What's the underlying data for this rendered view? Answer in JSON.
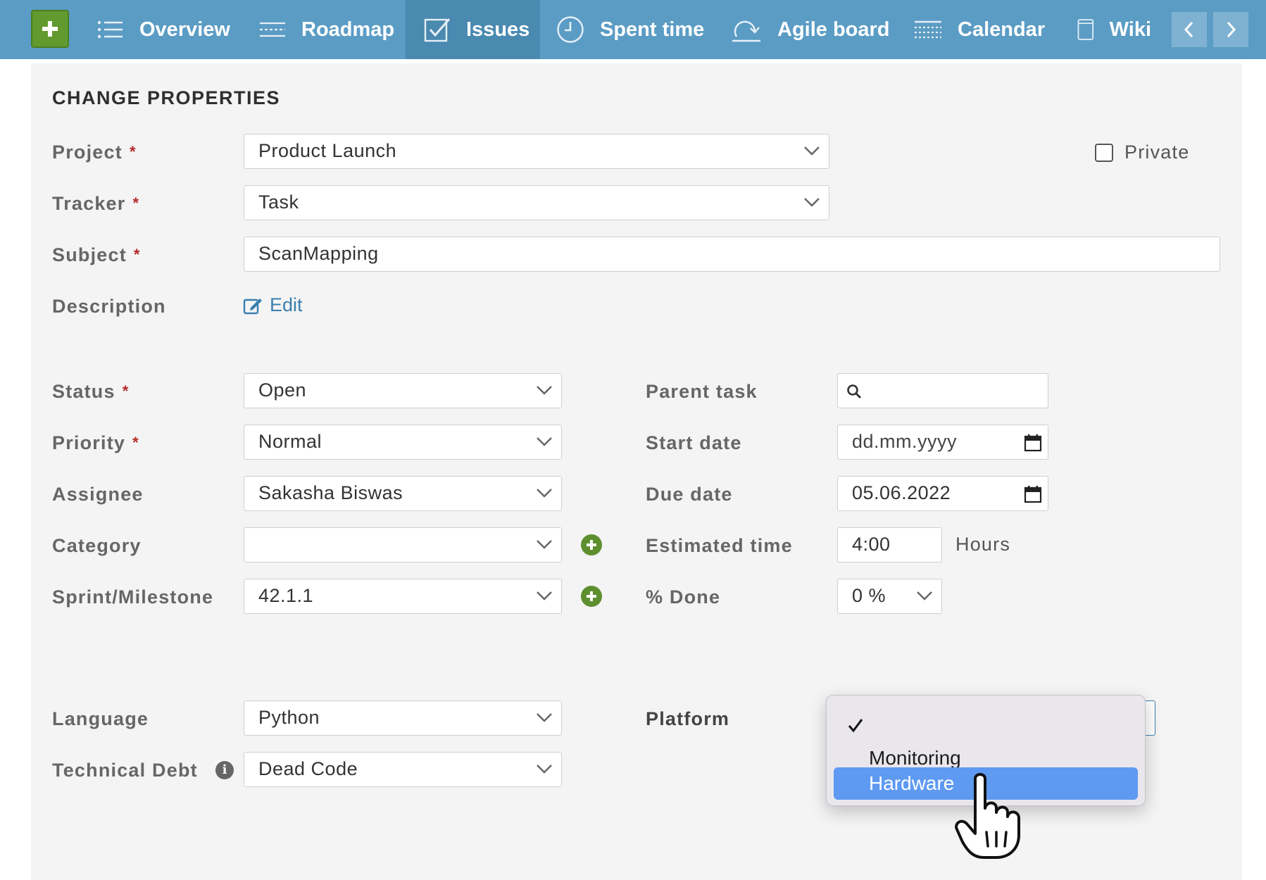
{
  "nav": {
    "add_label": "+",
    "items": [
      {
        "label": "Overview",
        "icon": "list-icon"
      },
      {
        "label": "Roadmap",
        "icon": "roadmap-icon"
      },
      {
        "label": "Issues",
        "icon": "checkbox-icon",
        "active": true
      },
      {
        "label": "Spent time",
        "icon": "clock-icon"
      },
      {
        "label": "Agile board",
        "icon": "agile-icon"
      },
      {
        "label": "Calendar",
        "icon": "calendar-icon"
      },
      {
        "label": "Wiki",
        "icon": "book-icon"
      }
    ],
    "prev_icon": "chevron-left-icon",
    "next_icon": "chevron-right-icon"
  },
  "form": {
    "title": "CHANGE PROPERTIES",
    "private_label": "Private",
    "private_checked": false,
    "project": {
      "label": "Project",
      "required": "*",
      "value": "Product Launch"
    },
    "tracker": {
      "label": "Tracker",
      "required": "*",
      "value": "Task"
    },
    "subject": {
      "label": "Subject",
      "required": "*",
      "value": "ScanMapping"
    },
    "description": {
      "label": "Description",
      "edit_label": "Edit"
    },
    "status": {
      "label": "Status",
      "required": "*",
      "value": "Open"
    },
    "priority": {
      "label": "Priority",
      "required": "*",
      "value": "Normal"
    },
    "assignee": {
      "label": "Assignee",
      "value": "Sakasha Biswas"
    },
    "category": {
      "label": "Category",
      "value": ""
    },
    "sprint": {
      "label": "Sprint/Milestone",
      "value": "42.1.1"
    },
    "parent_task": {
      "label": "Parent task",
      "value": ""
    },
    "start_date": {
      "label": "Start date",
      "value": "dd.mm.yyyy"
    },
    "due_date": {
      "label": "Due date",
      "value": "05.06.2022"
    },
    "estimated_time": {
      "label": "Estimated time",
      "value": "4:00",
      "unit": "Hours"
    },
    "done": {
      "label": "% Done",
      "value": "0 %"
    },
    "language": {
      "label": "Language",
      "value": "Python"
    },
    "technical_debt": {
      "label": "Technical Debt",
      "value": "Dead Code"
    },
    "platform": {
      "label": "Platform",
      "options": [
        "",
        "Monitoring",
        "Hardware"
      ],
      "checked_index": 0,
      "highlighted": "Hardware"
    }
  },
  "colors": {
    "nav_bg": "#5b9cc4",
    "nav_active": "#4a89b0",
    "add_button": "#629a2f",
    "required": "#b52a2a",
    "link": "#3a7fb0",
    "highlight": "#5e99f2"
  }
}
